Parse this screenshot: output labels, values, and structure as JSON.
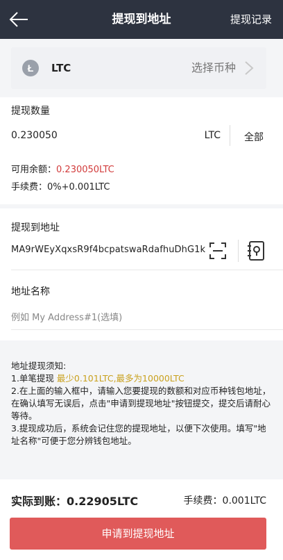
{
  "header": {
    "title": "提现到地址",
    "record": "提现记录",
    "back_icon": "arrow-left-icon"
  },
  "coin": {
    "name": "LTC",
    "select_label": "选择币种",
    "logo_icon": "litecoin-icon"
  },
  "amount": {
    "label": "提现数量",
    "value": "0.230050",
    "unit": "LTC",
    "all_label": "全部",
    "available_label": "可用余额：",
    "available_value": "0.230050LTC",
    "fee_text": "手续费：0%+0.001LTC"
  },
  "address": {
    "label": "提现到地址",
    "value": "MA9rWEyXqxsR9f4bcpatswaRdafhuDhG1k",
    "name_label": "地址名称",
    "name_placeholder": "例如 My Address#1(选填)"
  },
  "notice": {
    "title": "地址提现须知:",
    "line1_prefix": "1.单笔提现 ",
    "line1_highlight": "最少0.101LTC,最多为10000LTC",
    "line2": "2.在上面的输入框中，请输入您要提现的数额和对应币种钱包地址，在确认填写无误后，点击\"申请到提现地址\"按钮提交，提交后请耐心等待。",
    "line3": "3.提现成功后，系统会记住您的提现地址，以便下次使用。填写\"地址名称\"可便于您分辨钱包地址。"
  },
  "summary": {
    "actual_label": "实际到账：",
    "actual_value": "0.22905LTC",
    "fee_label": "手续费：",
    "fee_value": "0.001LTC",
    "submit": "申请到提现地址"
  },
  "colors": {
    "header_bg": "#2d3340",
    "highlight_red": "#d23b3b",
    "highlight_gold": "#c9a11e",
    "button_red": "#e05a5a"
  }
}
